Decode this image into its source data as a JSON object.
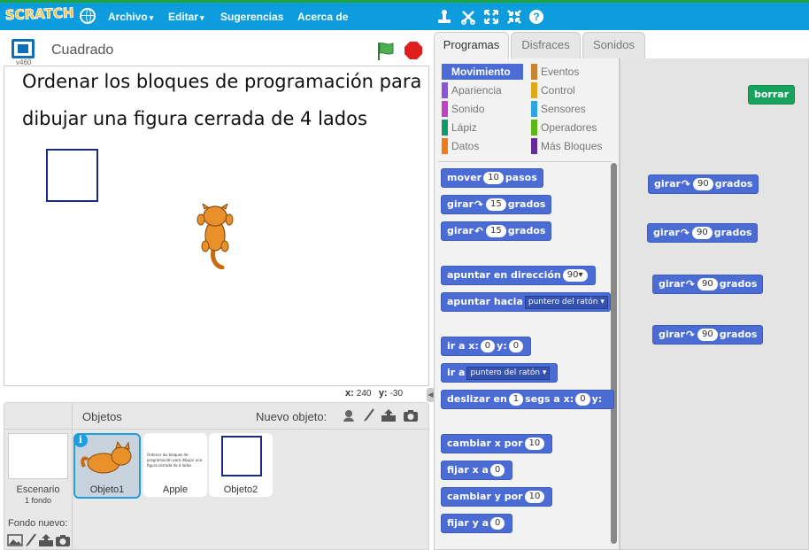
{
  "menubar": {
    "logo": "SCRATCH",
    "items": [
      {
        "label": "Archivo",
        "caret": "▾"
      },
      {
        "label": "Editar",
        "caret": "▾"
      },
      {
        "label": "Sugerencias"
      },
      {
        "label": "Acerca de"
      }
    ],
    "tool_icons": [
      "duplicate-icon",
      "delete-icon",
      "grow-icon",
      "shrink-icon",
      "help-icon"
    ],
    "help_glyph": "?"
  },
  "stage": {
    "title": "Cuadrado",
    "version": "v460",
    "text_line1": "Ordenar los bloques de programación para",
    "text_line2": "dibujar una figura cerrada de 4 lados",
    "coords": {
      "x_label": "x:",
      "x": "240",
      "y_label": "y:",
      "y": "-30"
    }
  },
  "sprites": {
    "header": "Objetos",
    "new_object": "Nuevo objeto:",
    "stage_label": "Escenario",
    "stage_backdrops": "1 fondo",
    "new_backdrop": "Fondo nuevo:",
    "items": [
      {
        "name": "Objeto1",
        "selected": true
      },
      {
        "name": "Apple",
        "thumb_text": "Ordenar los bloques de programación para dibujar una figura cerrada de 4 lados"
      },
      {
        "name": "Objeto2"
      }
    ]
  },
  "tabs": [
    "Programas",
    "Disfraces",
    "Sonidos"
  ],
  "categories": [
    {
      "label": "Movimiento",
      "color": "#4a6cd4",
      "selected": true
    },
    {
      "label": "Eventos",
      "color": "#c88330"
    },
    {
      "label": "Apariencia",
      "color": "#8a55d7"
    },
    {
      "label": "Control",
      "color": "#e1a91a"
    },
    {
      "label": "Sonido",
      "color": "#bb42c3"
    },
    {
      "label": "Sensores",
      "color": "#2ca5e2"
    },
    {
      "label": "Lápiz",
      "color": "#0e9a6c"
    },
    {
      "label": "Operadores",
      "color": "#5cb712"
    },
    {
      "label": "Datos",
      "color": "#ee7d16"
    },
    {
      "label": "Más Bloques",
      "color": "#632d99"
    }
  ],
  "palette_blocks": {
    "mover": {
      "a": "mover",
      "v": "10",
      "b": "pasos"
    },
    "girar_r": {
      "a": "girar",
      "v": "15",
      "b": "grados"
    },
    "girar_l": {
      "a": "girar",
      "v": "15",
      "b": "grados"
    },
    "apuntar_dir": {
      "a": "apuntar en dirección",
      "v": "90▾"
    },
    "apuntar_hacia": {
      "a": "apuntar hacia",
      "dd": "puntero del ratón ▾"
    },
    "ir_a_xy": {
      "a": "ir a x:",
      "x": "0",
      "b": "y:",
      "y": "0"
    },
    "ir_a": {
      "a": "ir a",
      "dd": "puntero del ratón ▾"
    },
    "deslizar": {
      "a": "deslizar en",
      "s": "1",
      "b": "segs a x:",
      "x": "0",
      "c": "y:"
    },
    "cambiar_x": {
      "a": "cambiar x por",
      "v": "10"
    },
    "fijar_x": {
      "a": "fijar x a",
      "v": "0"
    },
    "cambiar_y": {
      "a": "cambiar y por",
      "v": "10"
    },
    "fijar_y": {
      "a": "fijar y a",
      "v": "0"
    }
  },
  "script_blocks": {
    "borrar": "borrar",
    "girar": [
      {
        "a": "girar",
        "v": "90",
        "b": "grados"
      },
      {
        "a": "girar",
        "v": "90",
        "b": "grados"
      },
      {
        "a": "girar",
        "v": "90",
        "b": "grados"
      },
      {
        "a": "girar",
        "v": "90",
        "b": "grados"
      }
    ]
  }
}
